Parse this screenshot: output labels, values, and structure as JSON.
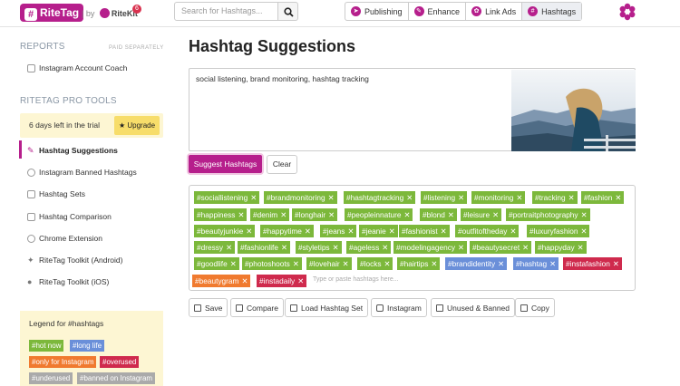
{
  "topbar": {
    "logo": "RiteTag",
    "by": "| by",
    "brand": "RiteKit",
    "notification_count": "6",
    "search_placeholder": "Search for Hashtags...",
    "nav": [
      {
        "label": "Publishing",
        "active": false
      },
      {
        "label": "Enhance",
        "active": false
      },
      {
        "label": "Link Ads",
        "active": false
      },
      {
        "label": "Hashtags",
        "active": true
      }
    ]
  },
  "sidebar": {
    "reports_title": "REPORTS",
    "reports_note": "PAID SEPARATELY",
    "reports_items": [
      "Instagram Account Coach"
    ],
    "pro_title": "RITETAG PRO TOOLS",
    "trial_text": "6 days left in the trial",
    "upgrade_label": "Upgrade",
    "pro_items": [
      "Hashtag Suggestions",
      "Instagram Banned Hashtags",
      "Hashtag Sets",
      "Hashtag Comparison",
      "Chrome Extension",
      "RiteTag Toolkit (Android)",
      "RiteTag Toolkit (iOS)"
    ],
    "legend": {
      "title": "Legend for #hashtags",
      "items": [
        {
          "label": "#hot now",
          "color": "#7cb83b"
        },
        {
          "label": "#long life",
          "color": "#6a8fd9"
        },
        {
          "label": "#only for Instagram",
          "color": "#f07a2f"
        },
        {
          "label": "#overused",
          "color": "#cf2a4d"
        },
        {
          "label": "#underused",
          "color": "#aaaaaa"
        },
        {
          "label": "#banned on Instagram",
          "color": "#aaaaaa"
        }
      ]
    }
  },
  "main": {
    "title": "Hashtag Suggestions",
    "textarea_value": "social listening, brand monitoring, hashtag tracking",
    "suggest_label": "Suggest Hashtags",
    "clear_label": "Clear",
    "tag_input_placeholder": "Type or paste hashtags here...",
    "tags": [
      {
        "label": "#sociallistening",
        "color": "green"
      },
      {
        "label": "#brandmonitoring",
        "color": "green"
      },
      {
        "label": "#hashtagtracking",
        "color": "green"
      },
      {
        "label": "#listening",
        "color": "green"
      },
      {
        "label": "#monitoring",
        "color": "green"
      },
      {
        "label": "#tracking",
        "color": "green"
      },
      {
        "label": "#fashion",
        "color": "green"
      },
      {
        "label": "#happiness",
        "color": "green"
      },
      {
        "label": "#denim",
        "color": "green"
      },
      {
        "label": "#longhair",
        "color": "green"
      },
      {
        "label": "#peopleinnature",
        "color": "green"
      },
      {
        "label": "#blond",
        "color": "green"
      },
      {
        "label": "#leisure",
        "color": "green"
      },
      {
        "label": "#portraitphotography",
        "color": "green"
      },
      {
        "label": "#beautyjunkie",
        "color": "green"
      },
      {
        "label": "#happytime",
        "color": "green"
      },
      {
        "label": "#jeans",
        "color": "green"
      },
      {
        "label": "#jeanie",
        "color": "green"
      },
      {
        "label": "#fashionist",
        "color": "green"
      },
      {
        "label": "#outfitoftheday",
        "color": "green"
      },
      {
        "label": "#luxuryfashion",
        "color": "green"
      },
      {
        "label": "#dressy",
        "color": "green"
      },
      {
        "label": "#fashionlife",
        "color": "green"
      },
      {
        "label": "#styletips",
        "color": "green"
      },
      {
        "label": "#ageless",
        "color": "green"
      },
      {
        "label": "#modelingagency",
        "color": "green"
      },
      {
        "label": "#beautysecret",
        "color": "green"
      },
      {
        "label": "#happyday",
        "color": "green"
      },
      {
        "label": "#goodlife",
        "color": "green"
      },
      {
        "label": "#photoshoots",
        "color": "green"
      },
      {
        "label": "#lovehair",
        "color": "green"
      },
      {
        "label": "#locks",
        "color": "green"
      },
      {
        "label": "#hairtips",
        "color": "green"
      },
      {
        "label": "#brandidentity",
        "color": "blue"
      },
      {
        "label": "#hashtag",
        "color": "blue"
      },
      {
        "label": "#instafashion",
        "color": "red"
      },
      {
        "label": "#beautygram",
        "color": "orange"
      },
      {
        "label": "#instadaily",
        "color": "red"
      }
    ],
    "actions": [
      "Save",
      "Compare",
      "Load Hashtag Set",
      "Instagram",
      "Unused & Banned",
      "Copy"
    ]
  }
}
